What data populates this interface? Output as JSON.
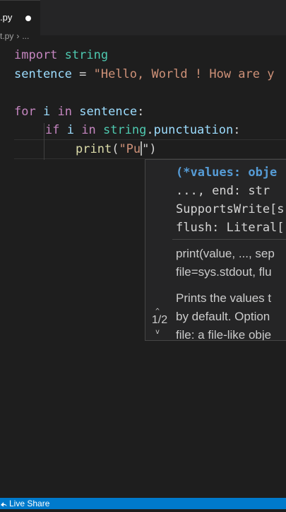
{
  "tab": {
    "label": ".py"
  },
  "breadcrumb": {
    "file": "t.py",
    "separator": "›",
    "more": "..."
  },
  "code": {
    "l1": {
      "kw": "import",
      "mod": "string"
    },
    "l2": {
      "var": "sentence",
      "op": " = ",
      "str": "\"Hello, World ! How are y"
    },
    "l4": {
      "kw": "for",
      "var": "i",
      "in": "in",
      "target": "sentence",
      "colon": ":"
    },
    "l5": {
      "kw": "if",
      "var": "i",
      "in": "in",
      "mod": "string",
      "dot": ".",
      "attr": "punctuation",
      "colon": ":"
    },
    "l6": {
      "fn": "print",
      "open": "(",
      "str": "\"Pu",
      "close": "\")"
    }
  },
  "hover": {
    "sig1_kw": "(*values: obje",
    "sig2": "..., end: str",
    "sig3": "SupportsWrite[s",
    "sig4": "flush: Literal[",
    "doc1": "print(value, ..., sep",
    "doc2": "file=sys.stdout, flu",
    "doc3": "Prints the values t",
    "doc4": "by default. Option",
    "doc5": "file: a file-like obje",
    "overload": "1/2"
  },
  "statusbar": {
    "live_share": "Live Share"
  }
}
